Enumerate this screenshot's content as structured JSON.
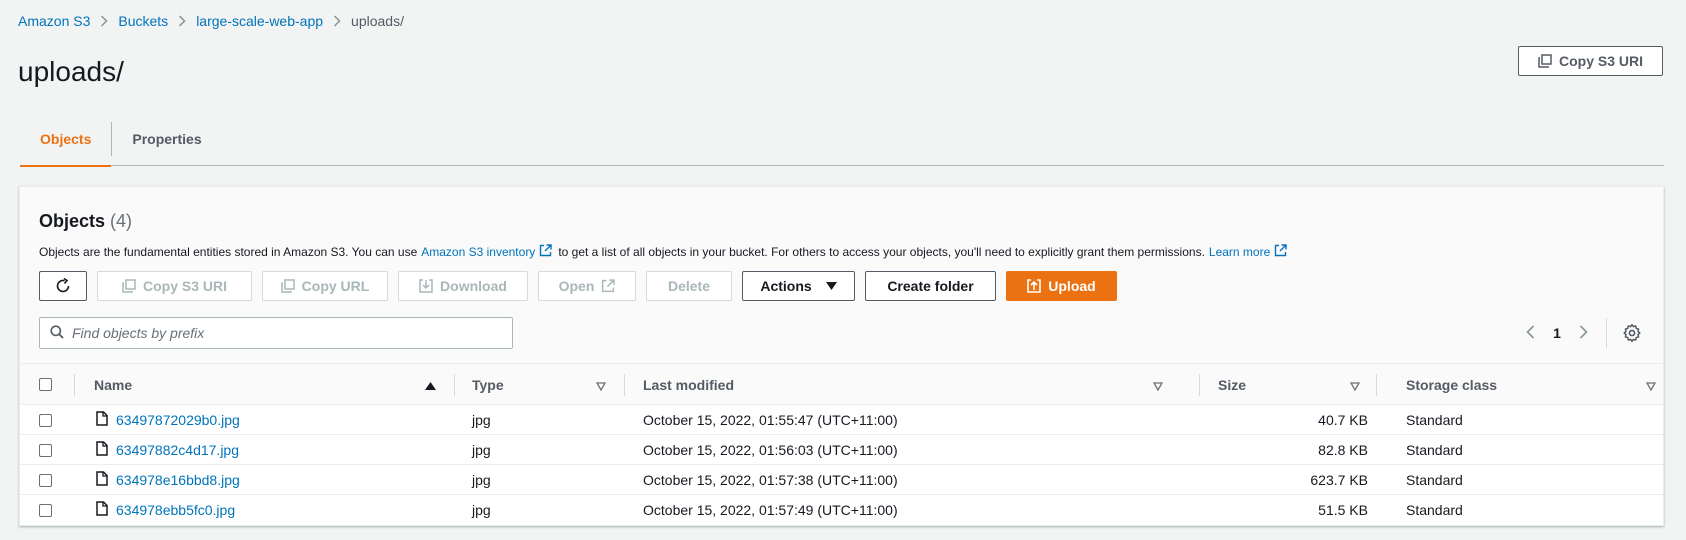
{
  "breadcrumb": {
    "items": [
      "Amazon S3",
      "Buckets",
      "large-scale-web-app"
    ],
    "current": "uploads/"
  },
  "header": {
    "title": "uploads/",
    "copy_uri_label": "Copy S3 URI"
  },
  "tabs": [
    {
      "label": "Objects",
      "active": true
    },
    {
      "label": "Properties",
      "active": false
    }
  ],
  "objects_panel": {
    "title": "Objects",
    "count": "(4)",
    "description_before": "Objects are the fundamental entities stored in Amazon S3. You can use",
    "inventory_link": "Amazon S3 inventory",
    "description_after": "to get a list of all objects in your bucket. For others to access your objects, you'll need to explicitly grant them permissions.",
    "learn_more": "Learn more",
    "toolbar": {
      "copy_uri": "Copy S3 URI",
      "copy_url": "Copy URL",
      "download": "Download",
      "open": "Open",
      "delete": "Delete",
      "actions": "Actions",
      "create_folder": "Create folder",
      "upload": "Upload"
    },
    "search": {
      "placeholder": "Find objects by prefix",
      "value": ""
    },
    "pagination": {
      "current_page": "1"
    }
  },
  "table": {
    "columns": [
      "Name",
      "Type",
      "Last modified",
      "Size",
      "Storage class"
    ],
    "rows": [
      {
        "name": "63497872029b0.jpg",
        "type": "jpg",
        "modified": "October 15, 2022, 01:55:47 (UTC+11:00)",
        "size": "40.7 KB",
        "storage": "Standard"
      },
      {
        "name": "63497882c4d17.jpg",
        "type": "jpg",
        "modified": "October 15, 2022, 01:56:03 (UTC+11:00)",
        "size": "82.8 KB",
        "storage": "Standard"
      },
      {
        "name": "634978e16bbd8.jpg",
        "type": "jpg",
        "modified": "October 15, 2022, 01:57:38 (UTC+11:00)",
        "size": "623.7 KB",
        "storage": "Standard"
      },
      {
        "name": "634978ebb5fc0.jpg",
        "type": "jpg",
        "modified": "October 15, 2022, 01:57:49 (UTC+11:00)",
        "size": "51.5 KB",
        "storage": "Standard"
      }
    ]
  },
  "colors": {
    "accent": "#ec7211",
    "link": "#0073bb",
    "text": "#16191f",
    "muted": "#545b64",
    "background": "#f2f3f3"
  },
  "icons": [
    "chevron-right-icon",
    "copy-icon",
    "refresh-icon",
    "download-icon",
    "external-link-icon",
    "caret-down-icon",
    "upload-icon",
    "search-icon",
    "chevron-left-icon",
    "gear-icon",
    "sort-ascending-icon",
    "sort-icon",
    "file-icon"
  ]
}
